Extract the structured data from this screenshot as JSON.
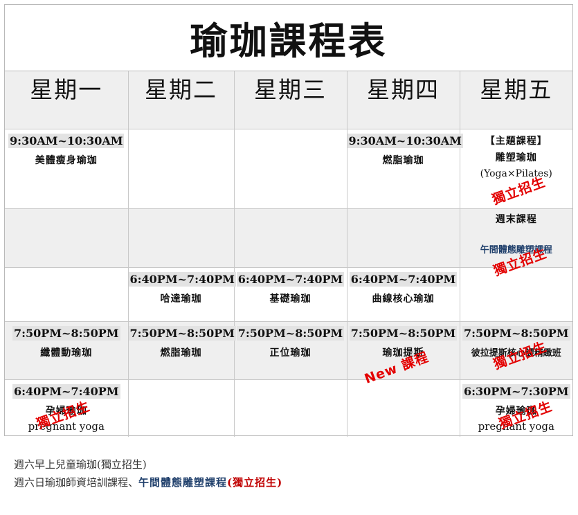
{
  "title": "瑜珈課程表",
  "days": [
    "星期一",
    "星期二",
    "星期三",
    "星期四",
    "星期五"
  ],
  "rows": {
    "r1": {
      "mon": {
        "time": "9:30AM~10:30AM",
        "class": "美體瘦身瑜珈"
      },
      "thu": {
        "time": "9:30AM~10:30AM",
        "class": "燃脂瑜珈"
      },
      "fri": {
        "line1": "【主題課程】",
        "line2": "雕塑瑜珈",
        "line3": "(Yoga×Pilates)",
        "stamp": "獨立招生"
      }
    },
    "r2": {
      "fri": {
        "line1": "週末課程",
        "line2": "午間體態雕塑課程",
        "stamp": "獨立招生"
      }
    },
    "r3": {
      "tue": {
        "time": "6:40PM~7:40PM",
        "class": "哈達瑜珈"
      },
      "wed": {
        "time": "6:40PM~7:40PM",
        "class": "基礎瑜珈"
      },
      "thu": {
        "time": "6:40PM~7:40PM",
        "class": "曲線核心瑜珈"
      }
    },
    "r4": {
      "mon": {
        "time": "7:50PM~8:50PM",
        "class": "纖體動瑜珈"
      },
      "tue": {
        "time": "7:50PM~8:50PM",
        "class": "燃脂瑜珈"
      },
      "wed": {
        "time": "7:50PM~8:50PM",
        "class": "正位瑜珈"
      },
      "thu": {
        "time": "7:50PM~8:50PM",
        "class": "瑜珈提斯",
        "stamp": "New 課程"
      },
      "fri": {
        "time": "7:50PM~8:50PM",
        "class": "彼拉提斯核心課精緻班",
        "stamp": "獨立招生"
      }
    },
    "r5": {
      "mon": {
        "time": "6:40PM~7:40PM",
        "class": "孕婦瑜珈",
        "en": "pregnant yoga",
        "stamp": "獨立招生"
      },
      "fri": {
        "time": "6:30PM~7:30PM",
        "class": "孕婦瑜珈",
        "en": "pregnant yoga",
        "stamp": "獨立招生"
      }
    }
  },
  "notes": {
    "line1": "週六早上兒童瑜珈(獨立招生)",
    "line2_a": "週六日瑜珈師資培訓課程、",
    "line2_b": "午間體態雕塑課程",
    "line2_c": "(獨立招生)"
  },
  "colors": {
    "stamp": "#e30000",
    "blue_text": "#1f3f6b",
    "header_bg": "#efefef",
    "time_bg": "#e3e3e3"
  }
}
